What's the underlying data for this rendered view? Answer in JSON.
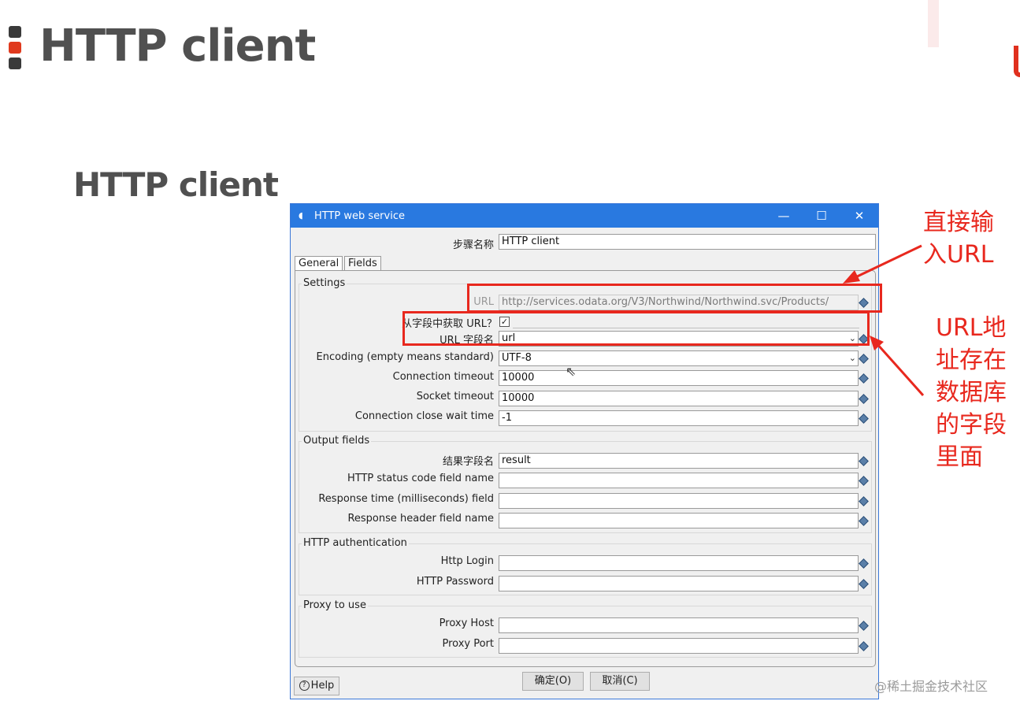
{
  "slide": {
    "title": "HTTP client",
    "subtitle": "HTTP client"
  },
  "dialog": {
    "title": "HTTP web service",
    "window_controls": [
      "minimize-icon",
      "maximize-icon",
      "close-icon"
    ],
    "window_glyphs": {
      "minimize": "—",
      "maximize": "☐",
      "close": "✕"
    },
    "step_name_label": "步骤名称",
    "step_name_value": "HTTP client",
    "tabs": [
      {
        "label": "General"
      },
      {
        "label": "Fields"
      }
    ],
    "settings": {
      "group_title": "Settings",
      "url_label": "URL",
      "url_value": "http://services.odata.org/V3/Northwind/Northwind.svc/Products/",
      "url_from_field_label": "从字段中获取 URL？",
      "url_from_field_checked": "✓",
      "url_field_name_label": "URL 字段名",
      "url_field_name_value": "url",
      "encoding_label": "Encoding (empty means standard)",
      "encoding_value": "UTF-8",
      "connection_timeout_label": "Connection timeout",
      "connection_timeout_value": "10000",
      "socket_timeout_label": "Socket timeout",
      "socket_timeout_value": "10000",
      "close_wait_label": "Connection close wait time",
      "close_wait_value": "-1"
    },
    "output": {
      "group_title": "Output fields",
      "result_field_label": "结果字段名",
      "result_field_value": "result",
      "status_code_label": "HTTP status code field name",
      "response_time_label": "Response time (milliseconds) field",
      "response_header_label": "Response header field name"
    },
    "auth": {
      "group_title": "HTTP authentication",
      "login_label": "Http Login",
      "password_label": "HTTP Password"
    },
    "proxy": {
      "group_title": "Proxy to use",
      "host_label": "Proxy Host",
      "port_label": "Proxy Port"
    },
    "buttons": {
      "help": "Help",
      "ok": "确定(O)",
      "cancel": "取消(C)"
    }
  },
  "annotations": {
    "direct_url": [
      "直接输",
      "入URL"
    ],
    "field_url": [
      "URL地",
      "址存在",
      "数据库",
      "的字段",
      "里面"
    ],
    "color": "#e8281e"
  },
  "watermark": "@稀土掘金技术社区"
}
